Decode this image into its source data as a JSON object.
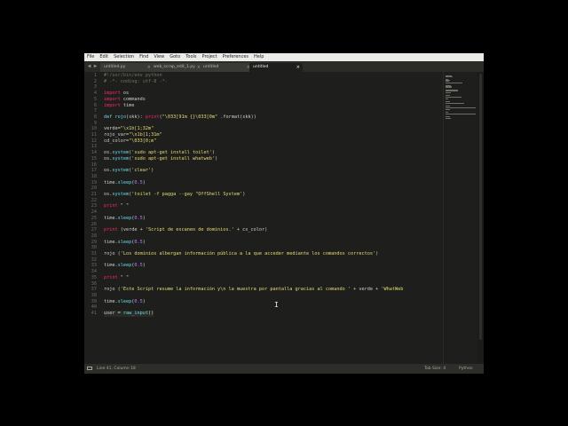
{
  "menu": [
    "File",
    "Edit",
    "Selection",
    "Find",
    "View",
    "Goto",
    "Tools",
    "Project",
    "Preferences",
    "Help"
  ],
  "tabs": [
    {
      "label": "untitled.py",
      "active": false
    },
    {
      "label": "web_scrap_edit_1.py",
      "active": false
    },
    {
      "label": "untitled",
      "active": false
    },
    {
      "label": "untitled",
      "active": true
    }
  ],
  "tab_arrows": {
    "left": "◀",
    "right": "▶"
  },
  "line_numbers": [
    "1",
    "2",
    "3",
    "4",
    "5",
    "6",
    "7",
    "8",
    "9",
    "10",
    "11",
    "12",
    "13",
    "14",
    "15",
    "16",
    "17",
    "18",
    "19",
    "20",
    "21",
    "22",
    "23",
    "24",
    "25",
    "26",
    "27",
    "28",
    "29",
    "30",
    "31",
    "32",
    "33",
    "34",
    "35",
    "36",
    "37",
    "38",
    "39",
    "40",
    "41"
  ],
  "code_lines": [
    [
      [
        "cm",
        "#!/usr/bin/env python"
      ]
    ],
    [
      [
        "cm",
        "# -*- coding: utf-8 -*-"
      ]
    ],
    [],
    [
      [
        "kw",
        "import"
      ],
      [
        "",
        " os"
      ]
    ],
    [
      [
        "kw",
        "import"
      ],
      [
        "",
        " commands"
      ]
    ],
    [
      [
        "kw",
        "import"
      ],
      [
        "",
        " time"
      ]
    ],
    [],
    [
      [
        "fn",
        "def"
      ],
      [
        "",
        " "
      ],
      [
        "fn",
        "rojo"
      ],
      [
        "",
        "(skk): "
      ],
      [
        "kw",
        "print"
      ],
      [
        "",
        "("
      ],
      [
        "st",
        "\"\\033[91m {}\\033[0m\""
      ],
      [
        "",
        " .format(skk))"
      ]
    ],
    [],
    [
      [
        "",
        "verde="
      ],
      [
        "st",
        "\"\\x1b[1;32m\""
      ]
    ],
    [
      [
        "",
        "rojo_var="
      ],
      [
        "st",
        "\"\\x1b[1;31m\""
      ]
    ],
    [
      [
        "",
        "cd_color="
      ],
      [
        "st",
        "\"\\033[0;m\""
      ]
    ],
    [],
    [
      [
        "",
        "os."
      ],
      [
        "fn",
        "system"
      ],
      [
        "",
        "("
      ],
      [
        "st",
        "'sudo apt-get install toilet'"
      ],
      [
        "",
        ")"
      ]
    ],
    [
      [
        "",
        "os."
      ],
      [
        "fn",
        "system"
      ],
      [
        "",
        "("
      ],
      [
        "st",
        "'sudo apt-get install whatweb'"
      ],
      [
        "",
        ")"
      ]
    ],
    [],
    [
      [
        "",
        "os."
      ],
      [
        "fn",
        "system"
      ],
      [
        "",
        "("
      ],
      [
        "st",
        "'clear'"
      ],
      [
        "",
        ")"
      ]
    ],
    [],
    [
      [
        "",
        "time."
      ],
      [
        "fn",
        "sleep"
      ],
      [
        "",
        "("
      ],
      [
        "nm",
        "0.5"
      ],
      [
        "",
        ")"
      ]
    ],
    [],
    [
      [
        "",
        "os."
      ],
      [
        "fn",
        "system"
      ],
      [
        "",
        "("
      ],
      [
        "st",
        "'toilet -f pagga --gay \"OffShell System'"
      ],
      [
        "",
        ")"
      ]
    ],
    [],
    [
      [
        "kw",
        "print"
      ],
      [
        "",
        " "
      ],
      [
        "st",
        "\" \""
      ]
    ],
    [],
    [
      [
        "",
        "time."
      ],
      [
        "fn",
        "sleep"
      ],
      [
        "",
        "("
      ],
      [
        "nm",
        "0.5"
      ],
      [
        "",
        ")"
      ]
    ],
    [],
    [
      [
        "kw",
        "print"
      ],
      [
        "",
        " (verde + "
      ],
      [
        "st",
        "'Script de escaneo de dominios.'"
      ],
      [
        "",
        " + cs_color)"
      ]
    ],
    [],
    [
      [
        "",
        "time."
      ],
      [
        "fn",
        "sleep"
      ],
      [
        "",
        "("
      ],
      [
        "nm",
        "0.5"
      ],
      [
        "",
        ")"
      ]
    ],
    [],
    [
      [
        "",
        "rojo ("
      ],
      [
        "st",
        "'Los dominios albergan información pública a la que acceder mediante los comandos correctos'"
      ],
      [
        "",
        ")"
      ]
    ],
    [],
    [
      [
        "",
        "time."
      ],
      [
        "fn",
        "sleep"
      ],
      [
        "",
        "("
      ],
      [
        "nm",
        "0.5"
      ],
      [
        "",
        ")"
      ]
    ],
    [],
    [
      [
        "kw",
        "print"
      ],
      [
        "",
        " "
      ],
      [
        "st",
        "\" \""
      ]
    ],
    [],
    [
      [
        "",
        "rojo ("
      ],
      [
        "st",
        "'Este Script resume la información y\\n la muestra por pantalla gracias al comando '"
      ],
      [
        "",
        " + verde + "
      ],
      [
        "st",
        "'WhatWeb"
      ]
    ],
    [],
    [
      [
        "",
        "time."
      ],
      [
        "fn",
        "sleep"
      ],
      [
        "",
        "("
      ],
      [
        "nm",
        "0.5"
      ],
      [
        "",
        ")"
      ]
    ],
    [],
    [
      [
        "",
        "user = "
      ],
      [
        "fn",
        "raw_input"
      ],
      [
        "",
        "()"
      ]
    ]
  ],
  "status_bar": {
    "position": "Line 41, Column 18",
    "tab_size": "Tab Size: 4",
    "syntax": "Python"
  },
  "icons": {
    "panel": "panel-toggle-icon",
    "cursor": "mouse-cursor-icon"
  }
}
